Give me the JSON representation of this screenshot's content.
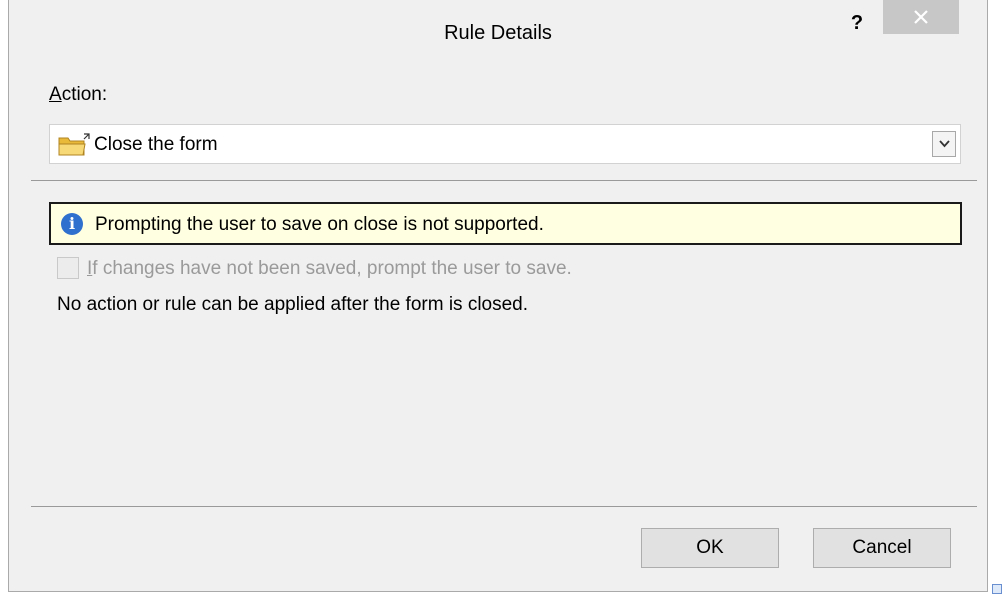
{
  "window": {
    "title": "Rule Details",
    "help_label": "?",
    "close_icon": "close-icon"
  },
  "action": {
    "label_accel": "A",
    "label_rest": "ction:",
    "selected_value": "Close the form",
    "icon": "folder-icon",
    "dropdown_icon": "chevron-down-icon"
  },
  "info": {
    "icon": "info-icon",
    "icon_glyph": "i",
    "message": "Prompting the user to save on close is not supported."
  },
  "prompt_checkbox": {
    "label_accel": "I",
    "label_rest": "f changes have not been saved, prompt the user to save.",
    "checked": false,
    "disabled": true
  },
  "note": "No action or rule can be applied after the form is closed.",
  "buttons": {
    "ok": "OK",
    "cancel": "Cancel"
  },
  "colors": {
    "dialog_bg": "#f0f0f0",
    "info_bg": "#ffffe1",
    "info_icon": "#2f6fcd",
    "disabled_text": "#9a9a9a",
    "close_button_bg": "#c7c7c7"
  }
}
